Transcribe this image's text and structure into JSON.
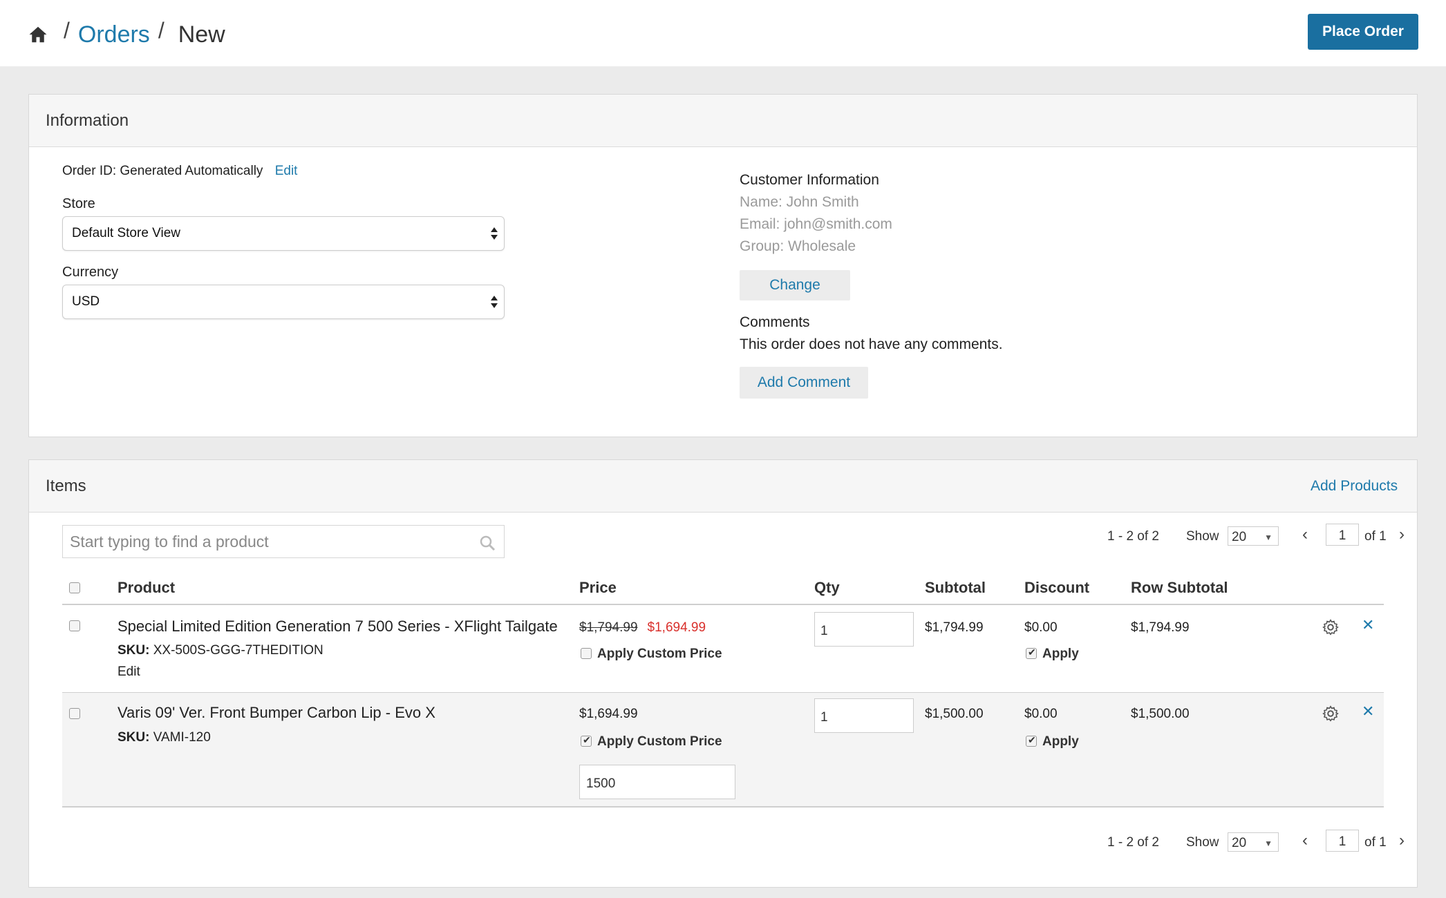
{
  "breadcrumb": {
    "orders": "Orders",
    "current": "New",
    "separator": "/"
  },
  "header": {
    "place_order_label": "Place Order"
  },
  "information": {
    "title": "Information",
    "order_id_text": "Order ID: Generated Automatically",
    "order_id_edit": "Edit",
    "store_label": "Store",
    "store_value": "Default Store View",
    "currency_label": "Currency",
    "currency_value": "USD",
    "customer_title": "Customer Information",
    "customer_name": "Name: John Smith",
    "customer_email": "Email: john@smith.com",
    "customer_group": "Group: Wholesale",
    "change_label": "Change",
    "comments_title": "Comments",
    "comments_text": "This order does not have any comments.",
    "add_comment_label": "Add Comment"
  },
  "items": {
    "title": "Items",
    "add_products_label": "Add Products",
    "search_placeholder": "Start typing to find a product",
    "pager": {
      "count": "1 - 2 of 2",
      "show_label": "Show",
      "show_value": "20",
      "page": "1",
      "of_label": "of 1"
    },
    "columns": {
      "product": "Product",
      "price": "Price",
      "qty": "Qty",
      "subtotal": "Subtotal",
      "discount": "Discount",
      "row_subtotal": "Row Subtotal"
    },
    "rows": [
      {
        "name": "Special Limited Edition Generation 7 500 Series - XFlight Tailgate",
        "sku_label": "SKU:",
        "sku": "XX-500S-GGG-7THEDITION",
        "edit": "Edit",
        "old_price": "$1,794.99",
        "new_price": "$1,694.99",
        "apply_custom_price": "Apply Custom Price",
        "custom_checked": false,
        "qty": "1",
        "subtotal": "$1,794.99",
        "discount": "$0.00",
        "apply_label": "Apply",
        "apply_checked": true,
        "row_subtotal": "$1,794.99"
      },
      {
        "name": "Varis 09' Ver. Front Bumper Carbon Lip - Evo X",
        "sku_label": "SKU:",
        "sku": "VAMI-120",
        "price": "$1,694.99",
        "apply_custom_price": "Apply Custom Price",
        "custom_checked": true,
        "custom_value": "1500",
        "qty": "1",
        "subtotal": "$1,500.00",
        "discount": "$0.00",
        "apply_label": "Apply",
        "apply_checked": true,
        "row_subtotal": "$1,500.00"
      }
    ]
  },
  "colors": {
    "accent": "#1e7aab",
    "primary_button": "#1a6fa0",
    "sale_price": "#d9302c"
  }
}
